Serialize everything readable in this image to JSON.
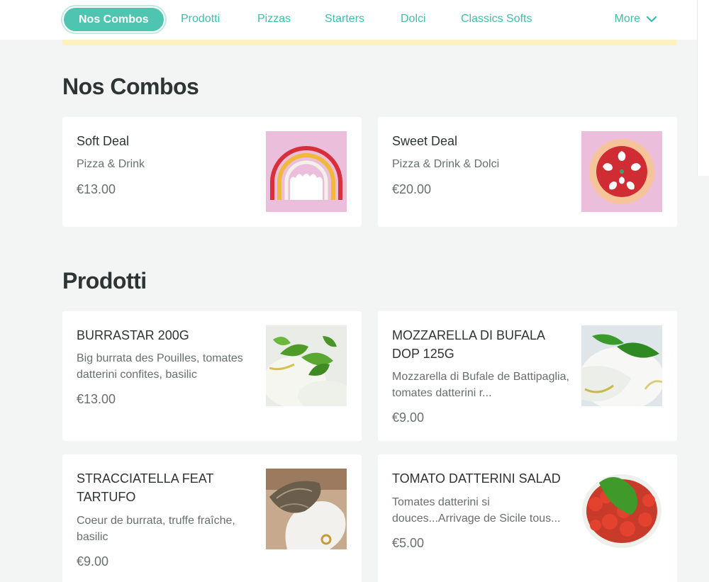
{
  "nav": {
    "active": "Nos Combos",
    "links": [
      "Prodotti",
      "Pizzas",
      "Starters",
      "Dolci",
      "Classics Softs"
    ],
    "more_label": "More",
    "more_icon": "chevron-down-icon"
  },
  "sections": {
    "combos": {
      "title": "Nos Combos",
      "items": [
        {
          "name": "Soft Deal",
          "description": "Pizza & Drink",
          "price": "€13.00",
          "image": "rainbow-illustration"
        },
        {
          "name": "Sweet Deal",
          "description": "Pizza & Drink & Dolci",
          "price": "€20.00",
          "image": "pizza-illustration"
        }
      ]
    },
    "prodotti": {
      "title": "Prodotti",
      "items": [
        {
          "name": "BURRASTAR 200G",
          "description": "Big burrata des Pouilles, tomates datterini confites, basilic",
          "price": "€13.00",
          "image": "burrata-photo"
        },
        {
          "name": "MOZZARELLA DI BUFALA DOP 125G",
          "description": "Mozzarella di Bufale de Battipaglia, tomates datterini r...",
          "price": "€9.00",
          "image": "mozzarella-photo"
        },
        {
          "name": "STRACCIATELLA FEAT TARTUFO",
          "description": "Coeur de burrata, truffe fraîche, basilic",
          "price": "€9.00",
          "image": "truffle-photo"
        },
        {
          "name": "TOMATO DATTERINI SALAD",
          "description": "Tomates datterini si douces...Arrivage de Sicile tous...",
          "price": "€5.00",
          "image": "tomato-salad-photo"
        }
      ]
    }
  },
  "colors": {
    "accent": "#4fc4b0",
    "background": "#f3f4f4",
    "banner": "#fdf2bd",
    "illustration_pink": "#ebbfdc"
  }
}
